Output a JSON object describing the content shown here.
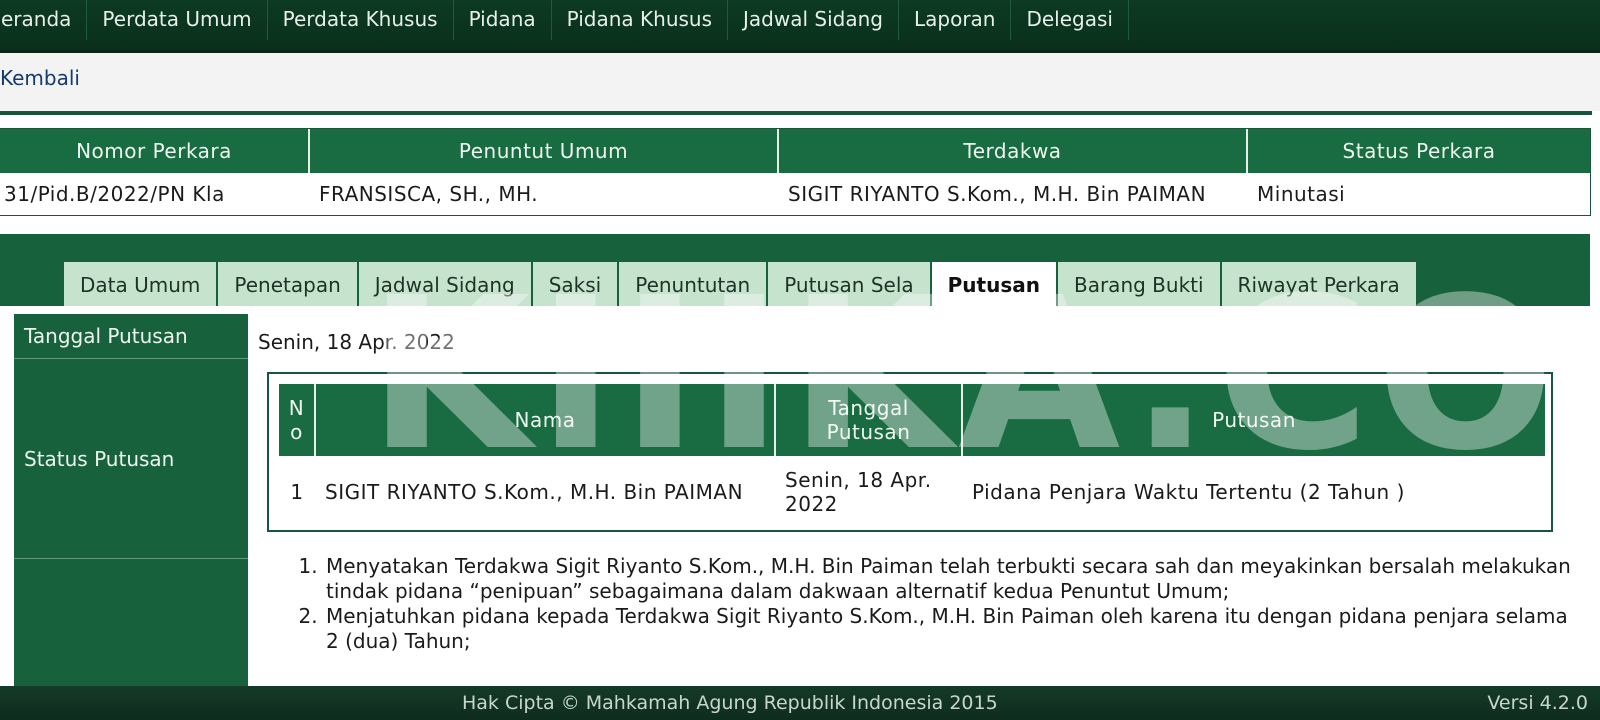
{
  "nav": {
    "items": [
      "eranda",
      "Perdata Umum",
      "Perdata Khusus",
      "Pidana",
      "Pidana Khusus",
      "Jadwal Sidang",
      "Laporan",
      "Delegasi"
    ]
  },
  "back_label": "Kembali",
  "case": {
    "headers": [
      "Nomor Perkara",
      "Penuntut Umum",
      "Terdakwa",
      "Status Perkara"
    ],
    "values": [
      "31/Pid.B/2022/PN Kla",
      "FRANSISCA, SH., MH.",
      "SIGIT RIYANTO S.Kom., M.H. Bin PAIMAN",
      "Minutasi"
    ]
  },
  "tabs": [
    "Data Umum",
    "Penetapan",
    "Jadwal Sidang",
    "Saksi",
    "Penuntutan",
    "Putusan Sela",
    "Putusan",
    "Barang Bukti",
    "Riwayat Perkara"
  ],
  "active_tab": "Putusan",
  "labels": {
    "tanggal_putusan": "Tanggal Putusan",
    "status_putusan": "Status Putusan"
  },
  "tanggal_putusan_value": "Senin, 18 Apr. 2022",
  "verdict": {
    "headers": [
      "N o",
      "Nama",
      "Tanggal Putusan",
      "Putusan"
    ],
    "row": {
      "no": "1",
      "nama": "SIGIT RIYANTO S.Kom., M.H. Bin PAIMAN",
      "tanggal": "Senin, 18 Apr. 2022",
      "putusan": "Pidana Penjara Waktu Tertentu (2 Tahun )"
    }
  },
  "amar": [
    "Menyatakan Terdakwa Sigit Riyanto S.Kom., M.H. Bin Paiman telah terbukti secara sah dan meyakinkan bersalah melakukan tindak pidana “penipuan” sebagaimana dalam dakwaan alternatif kedua Penuntut Umum;",
    "Menjatuhkan pidana kepada Terdakwa Sigit Riyanto S.Kom., M.H. Bin Paiman oleh karena itu dengan pidana penjara selama 2 (dua) Tahun;"
  ],
  "footer": {
    "copyright": "Hak Cipta © Mahkamah Agung Republik Indonesia 2015",
    "version": "Versi 4.2.0"
  },
  "watermark": "KIIIKA.CO",
  "colors": {
    "primary_green": "#196b42",
    "dark_nav": "#0c3a22",
    "tab_inactive": "#c6e3cd",
    "link_blue": "#153a6b"
  }
}
